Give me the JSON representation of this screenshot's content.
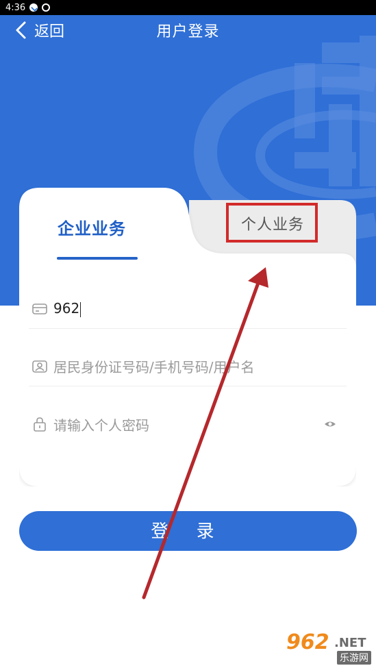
{
  "status_bar": {
    "time": "4:36"
  },
  "nav": {
    "back_label": "返回",
    "title": "用户登录"
  },
  "tabs": {
    "enterprise": "企业业务",
    "personal": "个人业务",
    "active": "enterprise"
  },
  "form": {
    "account": {
      "value": "962"
    },
    "id": {
      "placeholder": "居民身份证号码/手机号码/用户名"
    },
    "password": {
      "placeholder": "请输入个人密码"
    }
  },
  "login_button": "登 录",
  "watermark": {
    "number": "962",
    "net": ".NET",
    "cn": "乐游网"
  },
  "colors": {
    "brand_blue": "#2f6fd6",
    "highlight_red": "#d22b2b",
    "arrow_red": "#b5282c"
  }
}
